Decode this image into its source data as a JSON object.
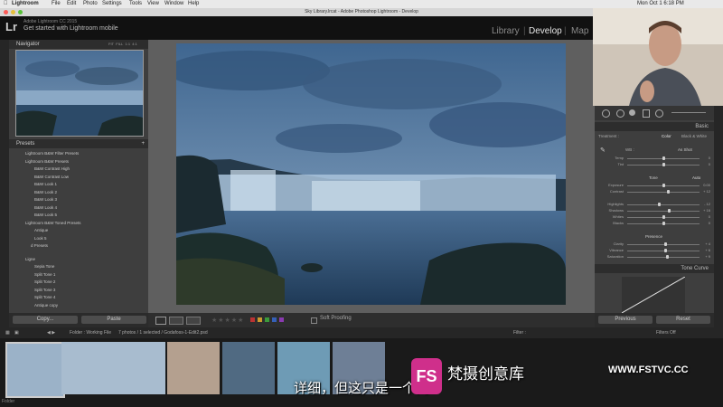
{
  "menubar": {
    "items": [
      "Lightroom",
      "File",
      "Edit",
      "Photo",
      "Settings",
      "Tools",
      "View",
      "Window",
      "Help"
    ],
    "clock": "Mon Oct 1  6:18 PM"
  },
  "window": {
    "title": "Sky Library.lrcat - Adobe Photoshop Lightroom - Develop"
  },
  "identity": {
    "line1": "Adobe Lightroom CC 2015",
    "line2": "Get started with Lightroom mobile",
    "logo": "Lr"
  },
  "modules": {
    "library": "Library",
    "develop": "Develop",
    "map": "Map"
  },
  "navigator": {
    "title": "Navigator",
    "zoom": [
      "FIT",
      "FILL",
      "1:1",
      "4:1"
    ]
  },
  "presets": {
    "title": "Presets",
    "items": [
      "Lightroom B&W Filter Presets",
      "Lightroom B&W Presets",
      "B&W Contrast High",
      "B&W Contrast Low",
      "B&W Look 1",
      "B&W Look 2",
      "B&W Look 3",
      "B&W Look 4",
      "B&W Look 5",
      "Lightroom B&W Toned Presets",
      "Antique",
      "Look 5",
      "d Presets",
      "Ligne",
      "Sepia Tone",
      "Split Tone 1",
      "Split Tone 2",
      "Split Tone 3",
      "Split Tone 4",
      "Antique copy"
    ]
  },
  "leftbuttons": {
    "copy": "Copy...",
    "paste": "Paste"
  },
  "toolbar": {
    "soft_proofing": "Soft Proofing"
  },
  "basic": {
    "title": "Basic",
    "treatment_label": "Treatment :",
    "color": "Color",
    "bw": "Black & White",
    "wb_label": "WB :",
    "wb_value": "As Shot",
    "tone_label": "Tone",
    "auto": "Auto",
    "presence_label": "Presence",
    "sliders": [
      {
        "label": "Temp",
        "value": "0",
        "pos": 0.5
      },
      {
        "label": "Tint",
        "value": "0",
        "pos": 0.5
      },
      {
        "label": "Exposure",
        "value": "0.00",
        "pos": 0.5
      },
      {
        "label": "Contrast",
        "value": "+ 12",
        "pos": 0.56
      },
      {
        "label": "Highlights",
        "value": "- 12",
        "pos": 0.44
      },
      {
        "label": "Shadows",
        "value": "+ 16",
        "pos": 0.58
      },
      {
        "label": "Whites",
        "value": "0",
        "pos": 0.5
      },
      {
        "label": "Blacks",
        "value": "0",
        "pos": 0.5
      },
      {
        "label": "Clarity",
        "value": "+ 4",
        "pos": 0.52
      },
      {
        "label": "Vibrance",
        "value": "+ 6",
        "pos": 0.53
      },
      {
        "label": "Saturation",
        "value": "+ 9",
        "pos": 0.55
      }
    ]
  },
  "tonecurve": {
    "title": "Tone Curve"
  },
  "rightbuttons": {
    "previous": "Previous",
    "reset": "Reset"
  },
  "filmbar": {
    "source": "Folder : Working File",
    "count": "7 photos / 1 selected / Godafoss-1-Edit2.psd",
    "filter_label": "Filter :",
    "filters_off": "Filters Off",
    "folder_label": "Folder"
  },
  "subtitle": "详细，但这只是一个简",
  "watermark": {
    "brand": "梵摄创意库",
    "url": "WWW.FSTVC.CC",
    "logo": "FS"
  },
  "colors": {
    "accent": "#cf2f8b",
    "panel": "#3e3e3e",
    "center": "#5f5f5f"
  }
}
